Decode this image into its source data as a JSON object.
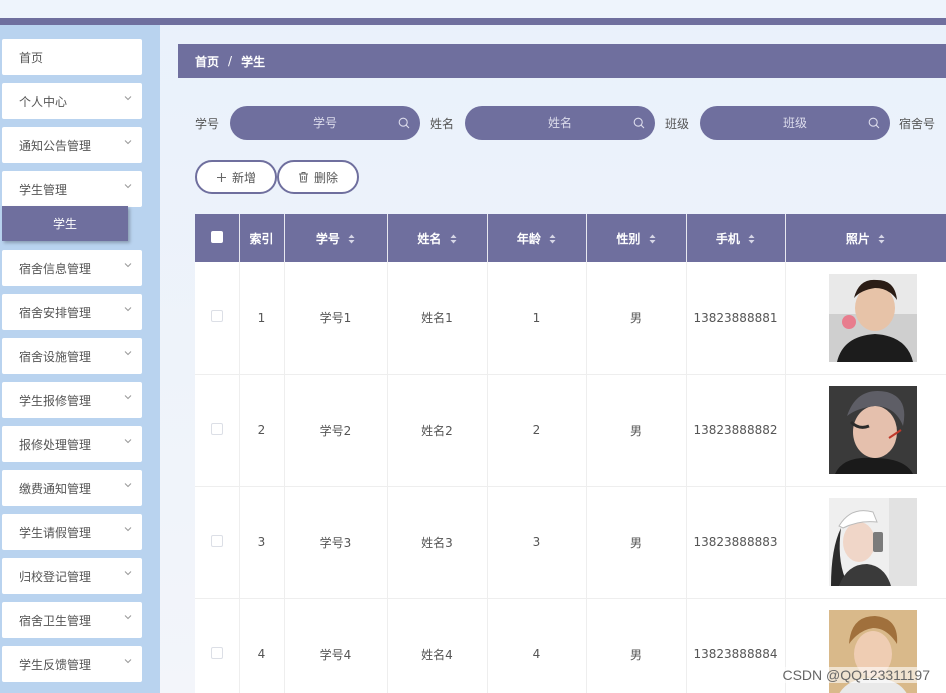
{
  "sidebar": {
    "items": [
      {
        "label": "首页",
        "has_chevron": false
      },
      {
        "label": "个人中心",
        "has_chevron": true
      },
      {
        "label": "通知公告管理",
        "has_chevron": true
      },
      {
        "label": "学生管理",
        "has_chevron": true
      },
      {
        "label": "宿舍信息管理",
        "has_chevron": true
      },
      {
        "label": "宿舍安排管理",
        "has_chevron": true
      },
      {
        "label": "宿舍设施管理",
        "has_chevron": true
      },
      {
        "label": "学生报修管理",
        "has_chevron": true
      },
      {
        "label": "报修处理管理",
        "has_chevron": true
      },
      {
        "label": "缴费通知管理",
        "has_chevron": true
      },
      {
        "label": "学生请假管理",
        "has_chevron": true
      },
      {
        "label": "归校登记管理",
        "has_chevron": true
      },
      {
        "label": "宿舍卫生管理",
        "has_chevron": true
      },
      {
        "label": "学生反馈管理",
        "has_chevron": true
      }
    ],
    "active_subitem": "学生"
  },
  "breadcrumb": {
    "home": "首页",
    "separator": "/",
    "current": "学生"
  },
  "search": {
    "fields": [
      {
        "label": "学号",
        "placeholder": "学号"
      },
      {
        "label": "姓名",
        "placeholder": "姓名"
      },
      {
        "label": "班级",
        "placeholder": "班级"
      }
    ],
    "extra_label": "宿舍号"
  },
  "actions": {
    "add_label": "新增",
    "delete_label": "删除"
  },
  "table": {
    "columns": [
      "索引",
      "学号",
      "姓名",
      "年龄",
      "性别",
      "手机",
      "照片"
    ],
    "rows": [
      {
        "index": "1",
        "student_no": "学号1",
        "name": "姓名1",
        "age": "1",
        "gender": "男",
        "phone": "13823888881"
      },
      {
        "index": "2",
        "student_no": "学号2",
        "name": "姓名2",
        "age": "2",
        "gender": "男",
        "phone": "13823888882"
      },
      {
        "index": "3",
        "student_no": "学号3",
        "name": "姓名3",
        "age": "3",
        "gender": "男",
        "phone": "13823888883"
      },
      {
        "index": "4",
        "student_no": "学号4",
        "name": "姓名4",
        "age": "4",
        "gender": "男",
        "phone": "13823888884"
      }
    ]
  },
  "watermark": "CSDN @QQ123311197",
  "colors": {
    "primary": "#6f6f9e",
    "sidebar_bg": "#b9d3ef",
    "page_bg": "#eef4fc"
  }
}
